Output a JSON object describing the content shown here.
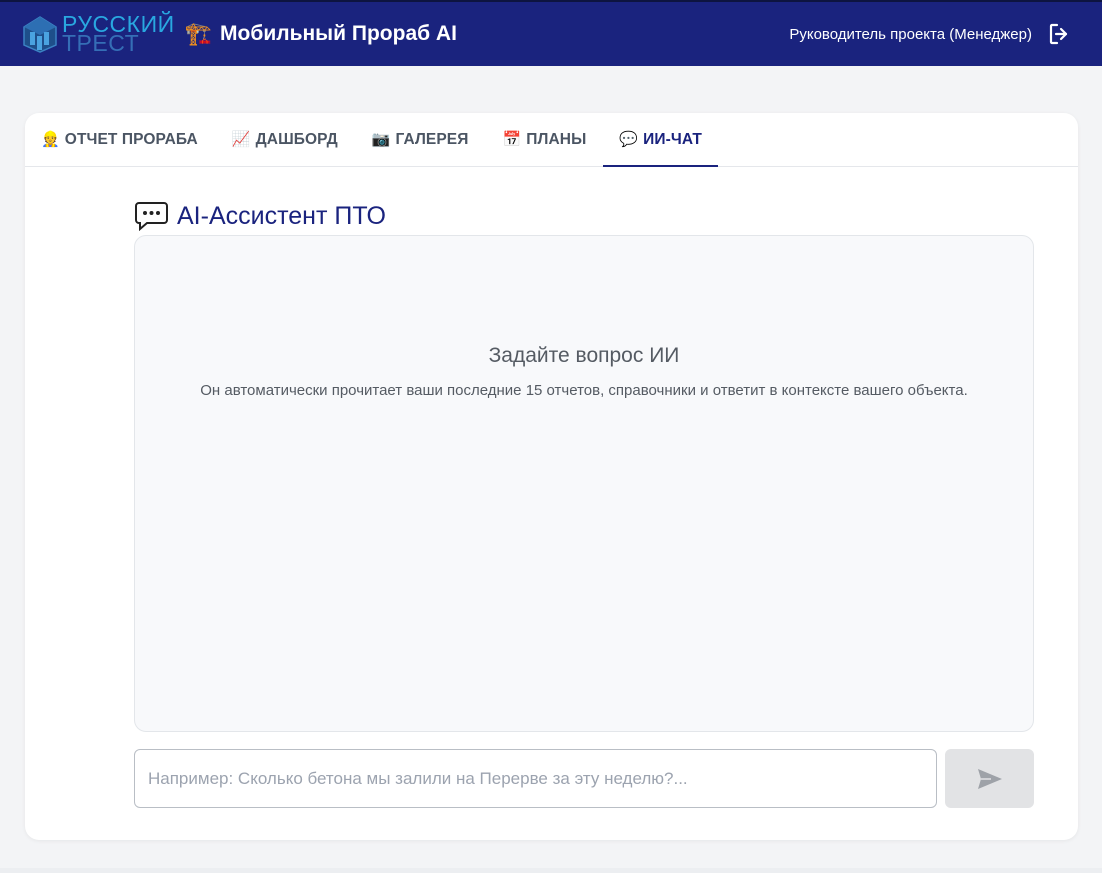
{
  "header": {
    "logo": {
      "line1": "РУССКИЙ",
      "line2": "ТРЕСТ",
      "icon": "building-logo-icon"
    },
    "title_icon": "🏗️",
    "title": "Мобильный Прораб AI",
    "user_role": "Руководитель проекта (Менеджер)",
    "logout_icon": "logout-icon"
  },
  "tabs": [
    {
      "icon": "👷",
      "label": "ОТЧЕТ ПРОРАБА",
      "active": false
    },
    {
      "icon": "📈",
      "label": "ДАШБОРД",
      "active": false
    },
    {
      "icon": "📷",
      "label": "ГАЛЕРЕЯ",
      "active": false
    },
    {
      "icon": "📅",
      "label": "ПЛАНЫ",
      "active": false
    },
    {
      "icon": "💬",
      "label": "ИИ-ЧАТ",
      "active": true
    }
  ],
  "section": {
    "title": "AI-Ассистент ПТО",
    "icon": "chat-bubble-icon"
  },
  "chat": {
    "empty_title": "Задайте вопрос ИИ",
    "empty_description": "Он автоматически прочитает ваши последние 15 отчетов, справочники и ответит в контексте вашего объекта.",
    "input_placeholder": "Например: Сколько бетона мы залили на Перерве за эту неделю?...",
    "input_value": "",
    "send_icon": "send-icon"
  },
  "colors": {
    "header_bg": "#1a237e",
    "accent": "#1a237e",
    "logo_blue": "#29a8e0",
    "page_bg": "#f3f4f6",
    "chat_bg": "#f8f9fb",
    "send_disabled": "#e2e3e5"
  }
}
